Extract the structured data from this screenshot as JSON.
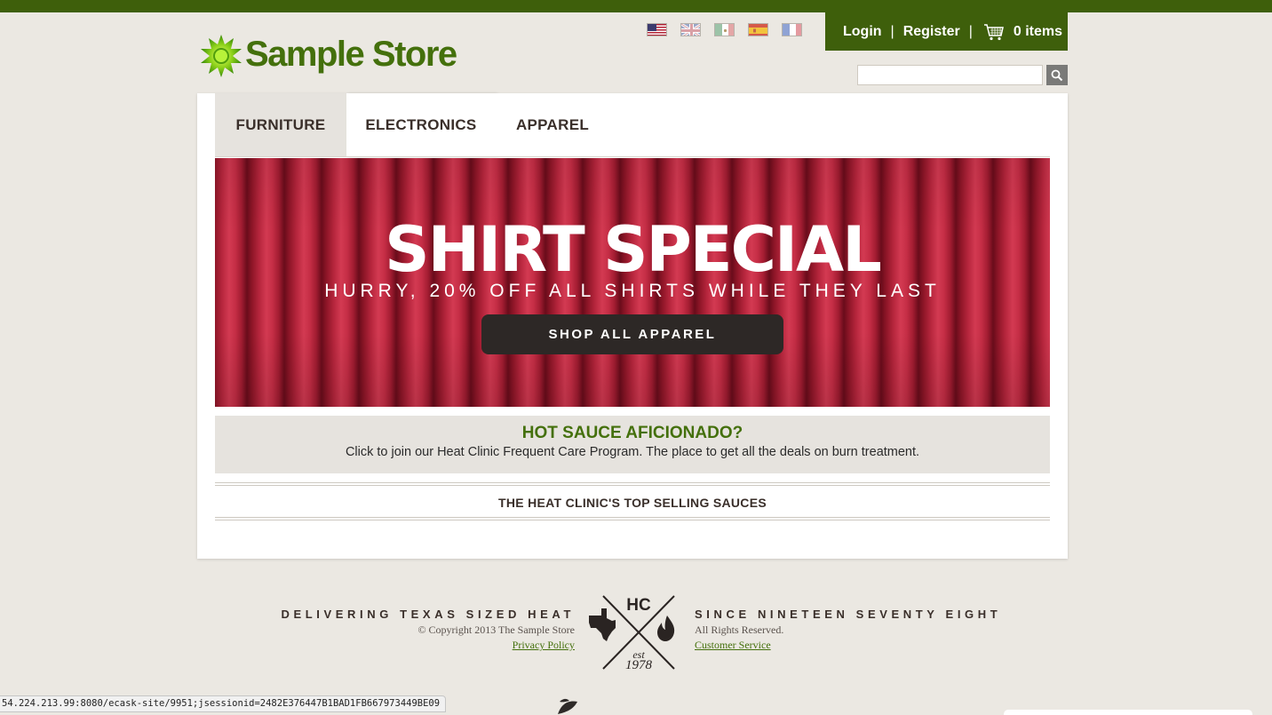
{
  "brand": {
    "name": "Sample Store",
    "accent": "#44700c",
    "dark_green": "#3e5f0b"
  },
  "languages": [
    {
      "icon": "flag-us-icon"
    },
    {
      "icon": "flag-uk-icon"
    },
    {
      "icon": "flag-mx-icon"
    },
    {
      "icon": "flag-es-icon"
    },
    {
      "icon": "flag-fr-icon"
    }
  ],
  "account": {
    "login": "Login",
    "separator": "|",
    "register": "Register",
    "cart_label": "0 items",
    "cart_icon": "shopping-cart-icon"
  },
  "search": {
    "value": "",
    "placeholder": "",
    "icon": "search-icon"
  },
  "nav": {
    "tabs": [
      {
        "label": "FURNITURE",
        "active": true
      },
      {
        "label": "ELECTRONICS"
      },
      {
        "label": "APPAREL"
      }
    ]
  },
  "banner": {
    "title": "SHIRT SPECIAL",
    "subtitle": "HURRY, 20% OFF ALL SHIRTS WHILE THEY LAST",
    "button": "SHOP ALL APPAREL",
    "color": "#b7263d"
  },
  "promo": {
    "title": "HOT SAUCE AFICIONADO?",
    "text": "Click to join our Heat Clinic Frequent Care Program. The place to get all the deals on burn treatment."
  },
  "section": {
    "title": "THE HEAT CLINIC'S TOP SELLING SAUCES"
  },
  "footer": {
    "tagline_left": "DELIVERING TEXAS SIZED HEAT",
    "copyright": "© Copyright 2013 The Sample Store",
    "privacy": "Privacy Policy",
    "tagline_right": "SINCE NINETEEN SEVENTY EIGHT",
    "rights": "All Rights Reserved.",
    "customer_service": "Customer Service",
    "logo": {
      "letters": "HC",
      "est": "est",
      "year": "1978"
    }
  },
  "status_bar": {
    "url": "54.224.213.99:8080/ecask-site/9951;jsessionid=2482E376447B1BAD1FB667973449BE09"
  }
}
